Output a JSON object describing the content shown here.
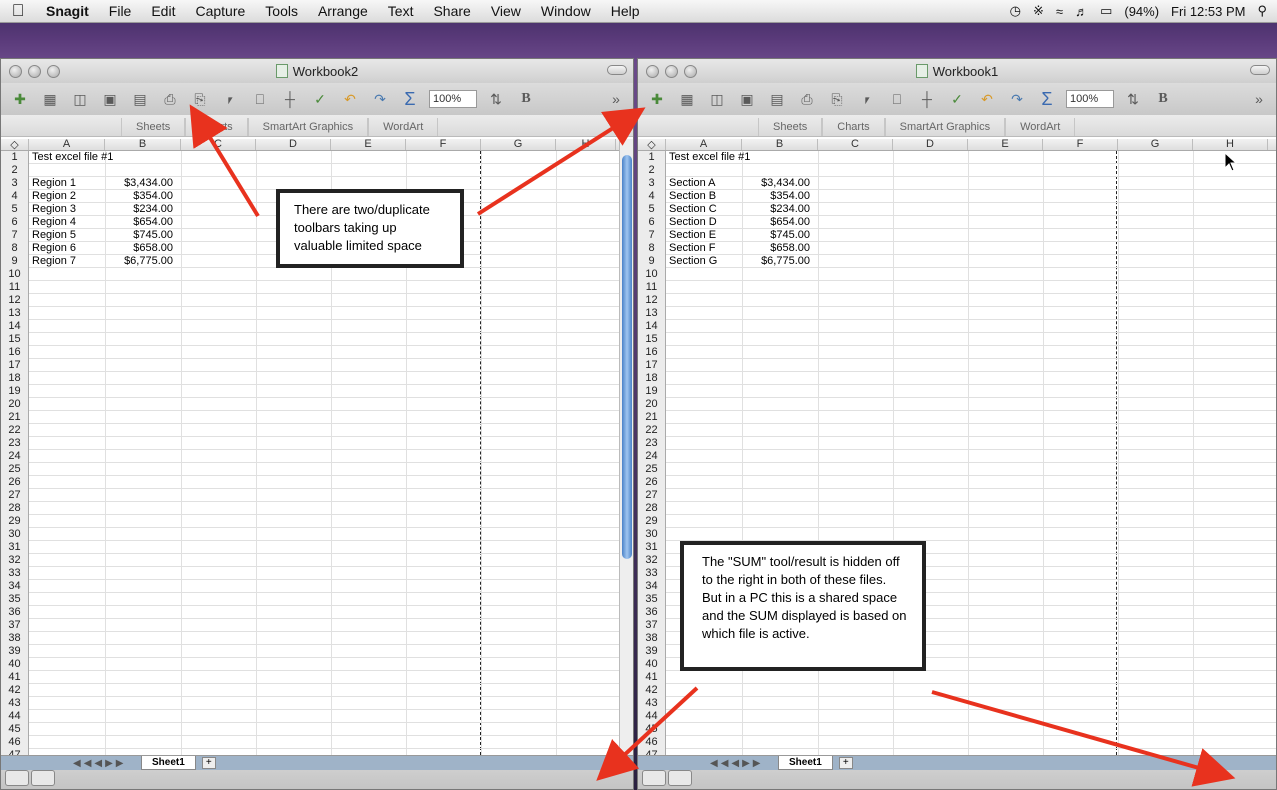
{
  "menubar": {
    "apple": "",
    "app": "Snagit",
    "items": [
      "File",
      "Edit",
      "Capture",
      "Tools",
      "Arrange",
      "Text",
      "Share",
      "View",
      "Window",
      "Help"
    ],
    "battery": "(94%)",
    "clock": "Fri 12:53 PM"
  },
  "windows": [
    {
      "title": "Workbook2",
      "zoom": "100%",
      "ribbon": [
        "Sheets",
        "Charts",
        "SmartArt Graphics",
        "WordArt"
      ],
      "columns": [
        "A",
        "B",
        "C",
        "D",
        "E",
        "F",
        "G",
        "H"
      ],
      "cells": {
        "a1": "Test excel file #1",
        "labels": [
          "Region 1",
          "Region 2",
          "Region 3",
          "Region 4",
          "Region 5",
          "Region 6",
          "Region 7"
        ],
        "values": [
          "$3,434.00",
          "$354.00",
          "$234.00",
          "$654.00",
          "$745.00",
          "$658.00",
          "$6,775.00"
        ]
      },
      "sheet_tab": "Sheet1",
      "add_sheet": "+"
    },
    {
      "title": "Workbook1",
      "zoom": "100%",
      "ribbon": [
        "Sheets",
        "Charts",
        "SmartArt Graphics",
        "WordArt"
      ],
      "columns": [
        "A",
        "B",
        "C",
        "D",
        "E",
        "F",
        "G",
        "H"
      ],
      "cells": {
        "a1": "Test excel file #1",
        "labels": [
          "Section A",
          "Section B",
          "Section C",
          "Section D",
          "Section E",
          "Section F",
          "Section G"
        ],
        "values": [
          "$3,434.00",
          "$354.00",
          "$234.00",
          "$654.00",
          "$745.00",
          "$658.00",
          "$6,775.00"
        ]
      },
      "sheet_tab": "Sheet1",
      "add_sheet": "+"
    }
  ],
  "toolbar_font_label": "B",
  "callouts": [
    "There are two/duplicate toolbars taking up valuable limited space",
    "The \"SUM\" tool/result is hidden off to the right in both of these files.  But in a PC this is a shared space and the SUM displayed is based on which file is active."
  ],
  "colors": {
    "arrow": "#e8321e",
    "scroll_thumb": "#4a82c8"
  }
}
